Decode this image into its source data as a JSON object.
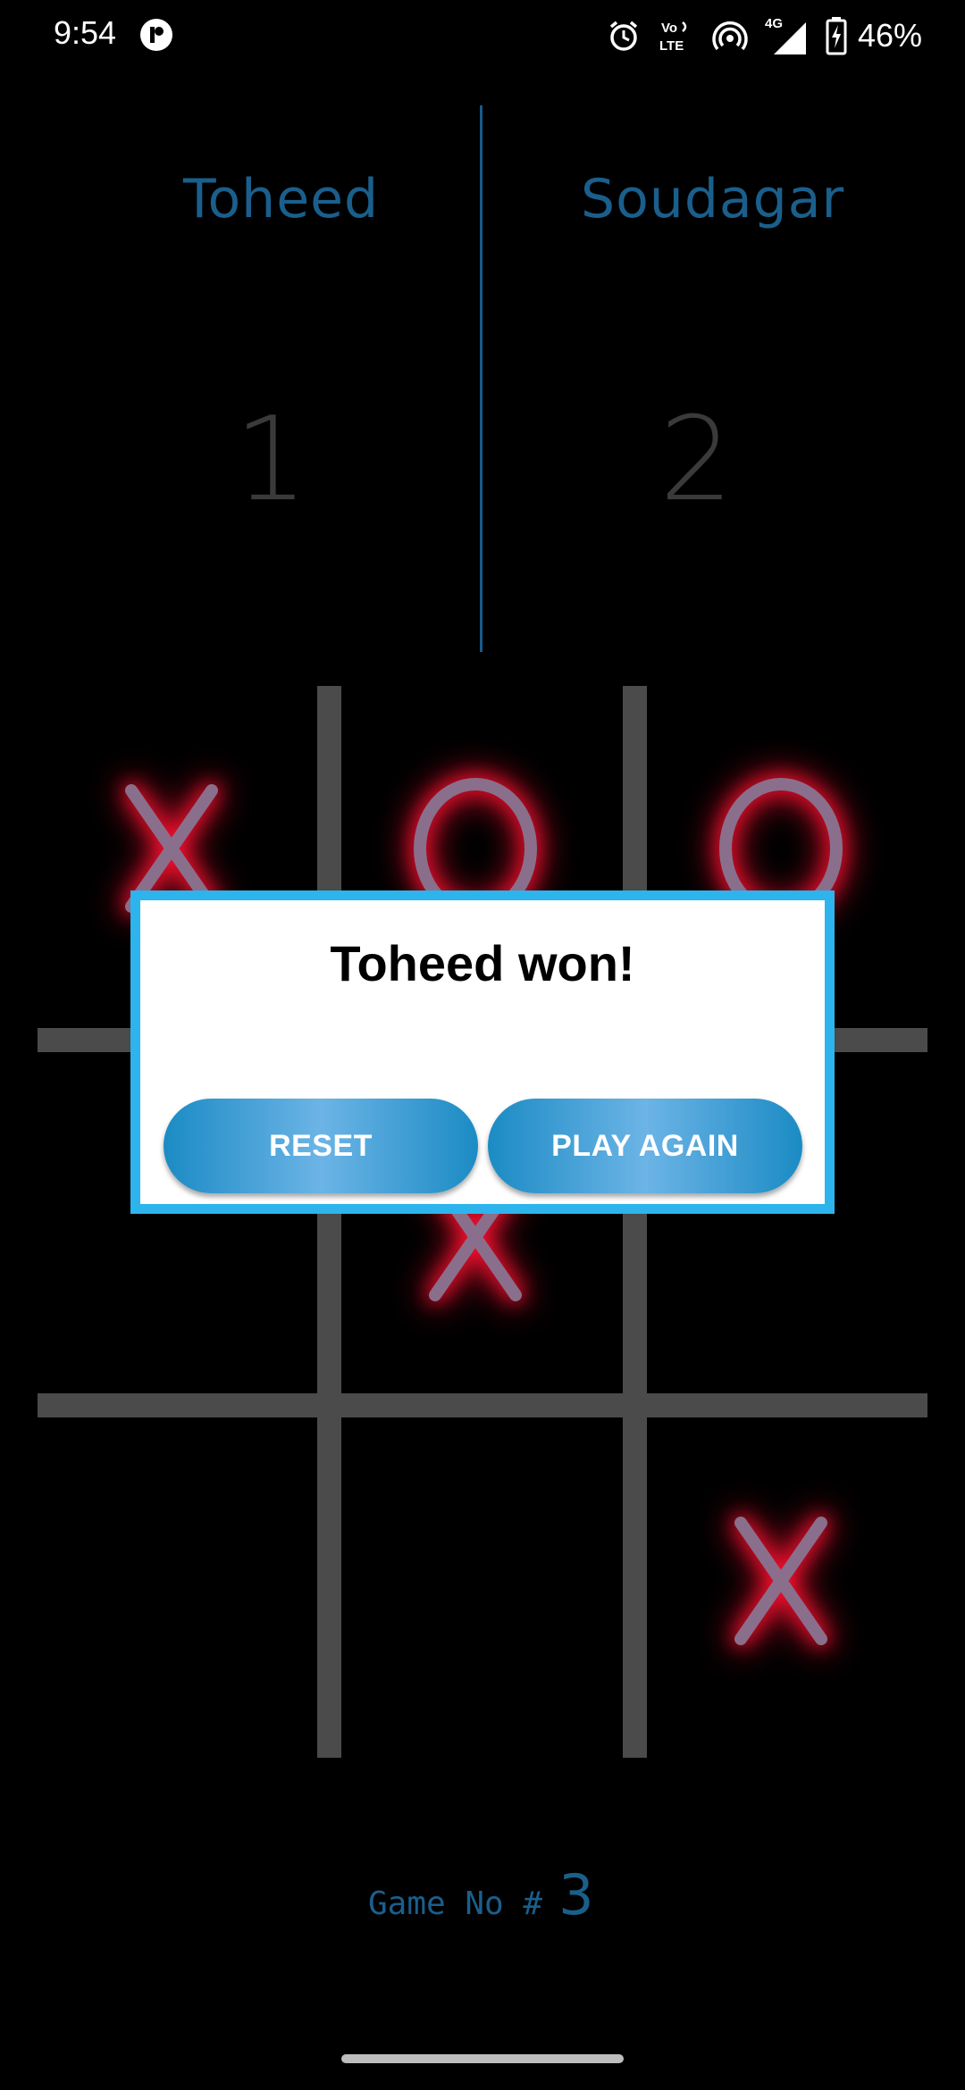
{
  "status_bar": {
    "time": "9:54",
    "battery": "46%",
    "icons": [
      "app-icon",
      "alarm-icon",
      "volte-icon",
      "hotspot-icon",
      "4g-signal-icon",
      "battery-charging-icon"
    ],
    "volte_top": "Vo",
    "volte_bottom": "LTE",
    "network": "4G"
  },
  "players": {
    "left": {
      "name": "Toheed",
      "score": "1"
    },
    "right": {
      "name": "Soudagar",
      "score": "2"
    }
  },
  "board": {
    "cells": [
      "X",
      "O",
      "O",
      "",
      "X",
      "",
      "",
      "",
      "X"
    ],
    "mark_color": "#ff1030",
    "mark_stroke": "#8a6f8c"
  },
  "dialog": {
    "title": "Toheed won!",
    "reset_label": "RESET",
    "play_again_label": "PLAY AGAIN"
  },
  "footer": {
    "game_no_label": "Game No #",
    "game_no_value": "3"
  },
  "colors": {
    "accent_blue": "#2eb4ec",
    "button_blue": "#1b8bc4",
    "name_blue": "#1a5f8c",
    "grid": "#4b4b4b"
  }
}
